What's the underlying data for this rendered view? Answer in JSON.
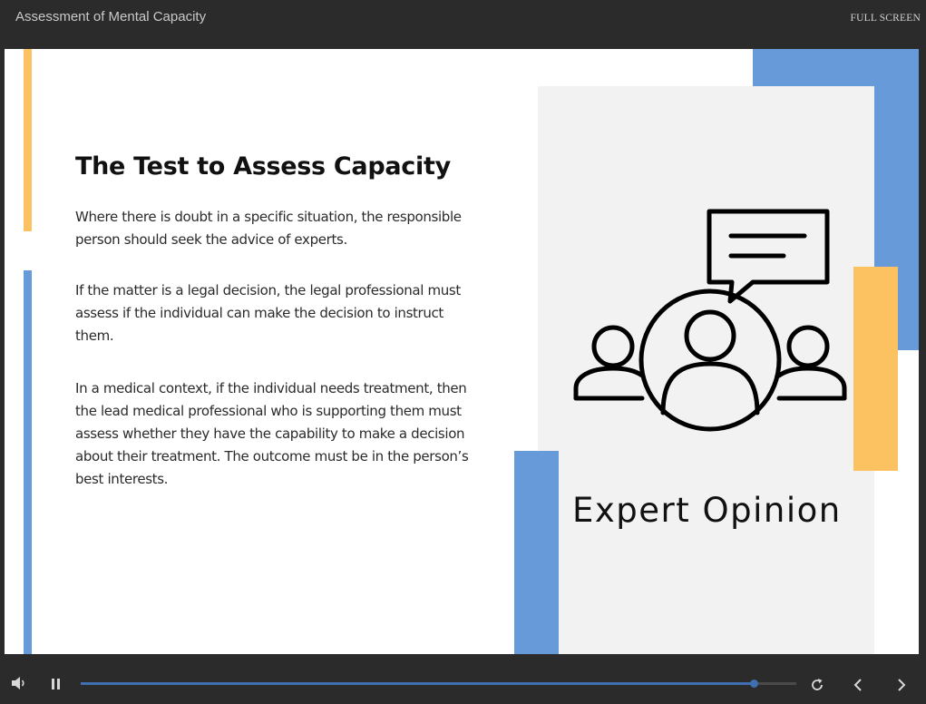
{
  "header": {
    "title": "Assessment of Mental Capacity",
    "fullscreen_label": "FULL SCREEN"
  },
  "slide": {
    "heading": "The Test to Assess Capacity",
    "paragraphs": [
      "Where there is doubt in a specific situation, the responsible person should seek the advice of experts.",
      "If the matter is a legal decision, the legal professional must assess if the individual can make the decision to instruct them.",
      "In a medical context, if the individual needs treatment, then the lead medical professional who is supporting them must assess whether they have the capability to make a decision about their treatment. The outcome must be in the person’s best interests."
    ],
    "image_caption": "Expert Opinion",
    "image_icon": "expert-group-speech-bubble-icon"
  },
  "controls": {
    "progress": 0.94,
    "icons": {
      "volume": "volume-icon",
      "pause": "pause-icon",
      "replay": "replay-icon",
      "prev": "chevron-left-icon",
      "next": "chevron-right-icon"
    }
  },
  "colors": {
    "accent_blue": "#669ad9",
    "accent_yellow": "#fcc262",
    "card_grey": "#f2f2f2",
    "chrome_dark": "#2b2b2b",
    "progress_blue": "#3f6fb0"
  }
}
